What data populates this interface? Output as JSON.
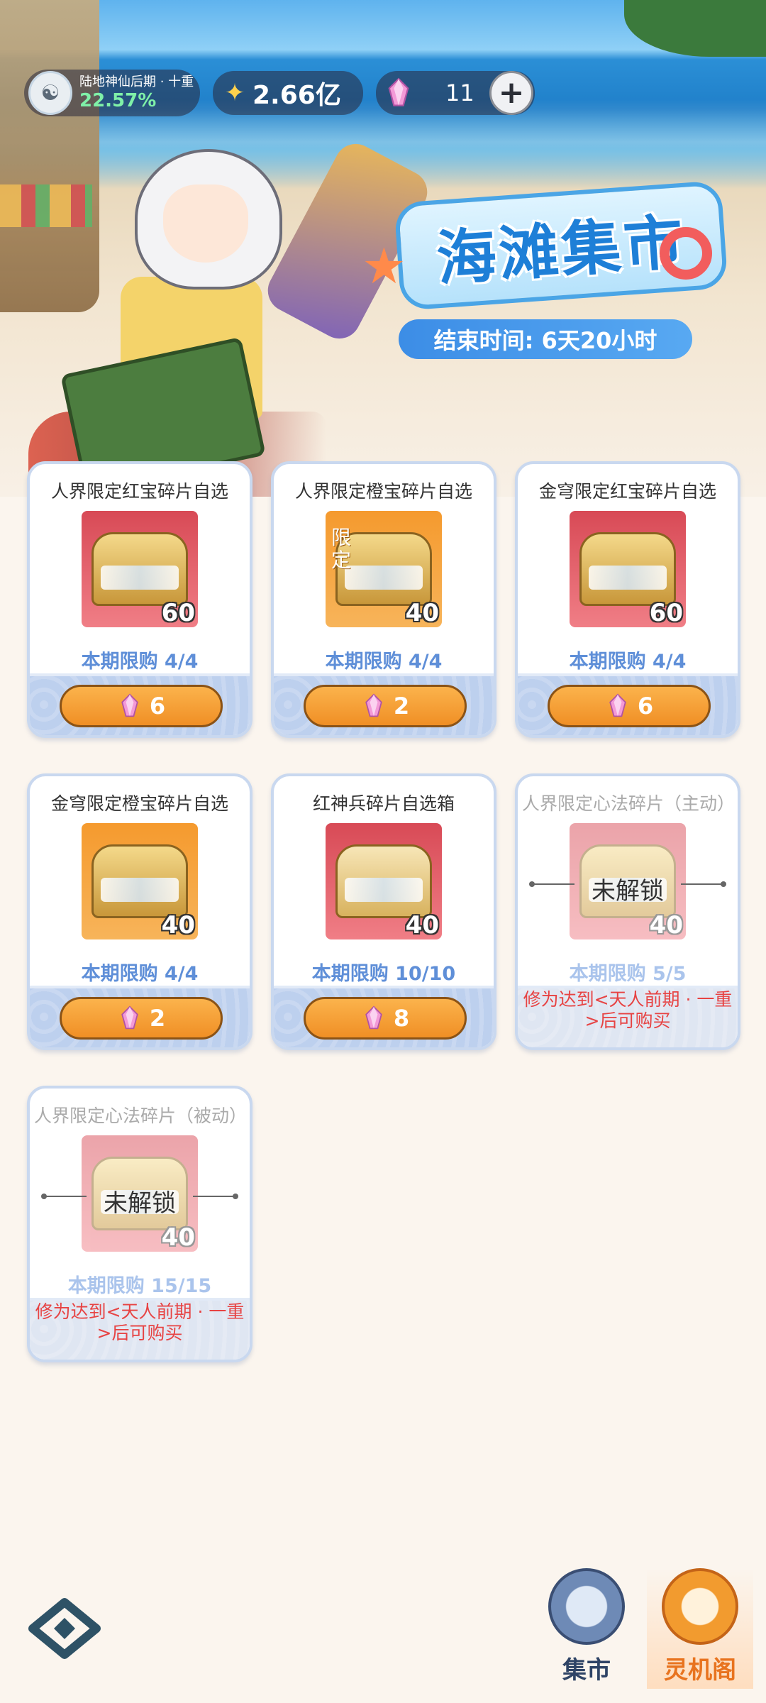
{
  "status": {
    "rank_title": "陆地神仙后期 · 十重",
    "rank_percent": "22.57%",
    "money": "2.66亿",
    "gems": "11",
    "plus": "+"
  },
  "event": {
    "title": "海滩集市",
    "end_time": "结束时间: 6天20小时"
  },
  "items": [
    {
      "title": "人界限定红宝碎片自选",
      "qty": "60",
      "limit": "本期限购 4/4",
      "price": "6",
      "color": "red",
      "tag": ""
    },
    {
      "title": "人界限定橙宝碎片自选",
      "qty": "40",
      "limit": "本期限购 4/4",
      "price": "2",
      "color": "orange",
      "tag": "限定"
    },
    {
      "title": "金穹限定红宝碎片自选",
      "qty": "60",
      "limit": "本期限购 4/4",
      "price": "6",
      "color": "red",
      "tag": ""
    },
    {
      "title": "金穹限定橙宝碎片自选",
      "qty": "40",
      "limit": "本期限购 4/4",
      "price": "2",
      "color": "orange",
      "tag": ""
    },
    {
      "title": "红神兵碎片自选箱",
      "qty": "40",
      "limit": "本期限购 10/10",
      "price": "8",
      "color": "red",
      "tag": ""
    },
    {
      "title": "人界限定心法碎片（主动）",
      "qty": "40",
      "limit": "本期限购 5/5",
      "lock": "未解锁",
      "requirement": "修为达到<天人前期 · 一重>后可购买",
      "color": "red"
    },
    {
      "title": "人界限定心法碎片（被动）",
      "qty": "40",
      "limit": "本期限购 15/15",
      "lock": "未解锁",
      "requirement": "修为达到<天人前期 · 一重>后可购买",
      "color": "red"
    }
  ],
  "nav": {
    "market": "集市",
    "pavilion": "灵机阁"
  },
  "colors": {
    "accent_orange": "#f08f25",
    "limit_blue": "#5f8fd8",
    "requirement_red": "#e74343",
    "title_blue": "#1e7fd7"
  },
  "icons": {
    "currency": "spirit-stone-icon",
    "gem": "pink-crystal-icon",
    "chest": "treasure-chest-icon"
  }
}
